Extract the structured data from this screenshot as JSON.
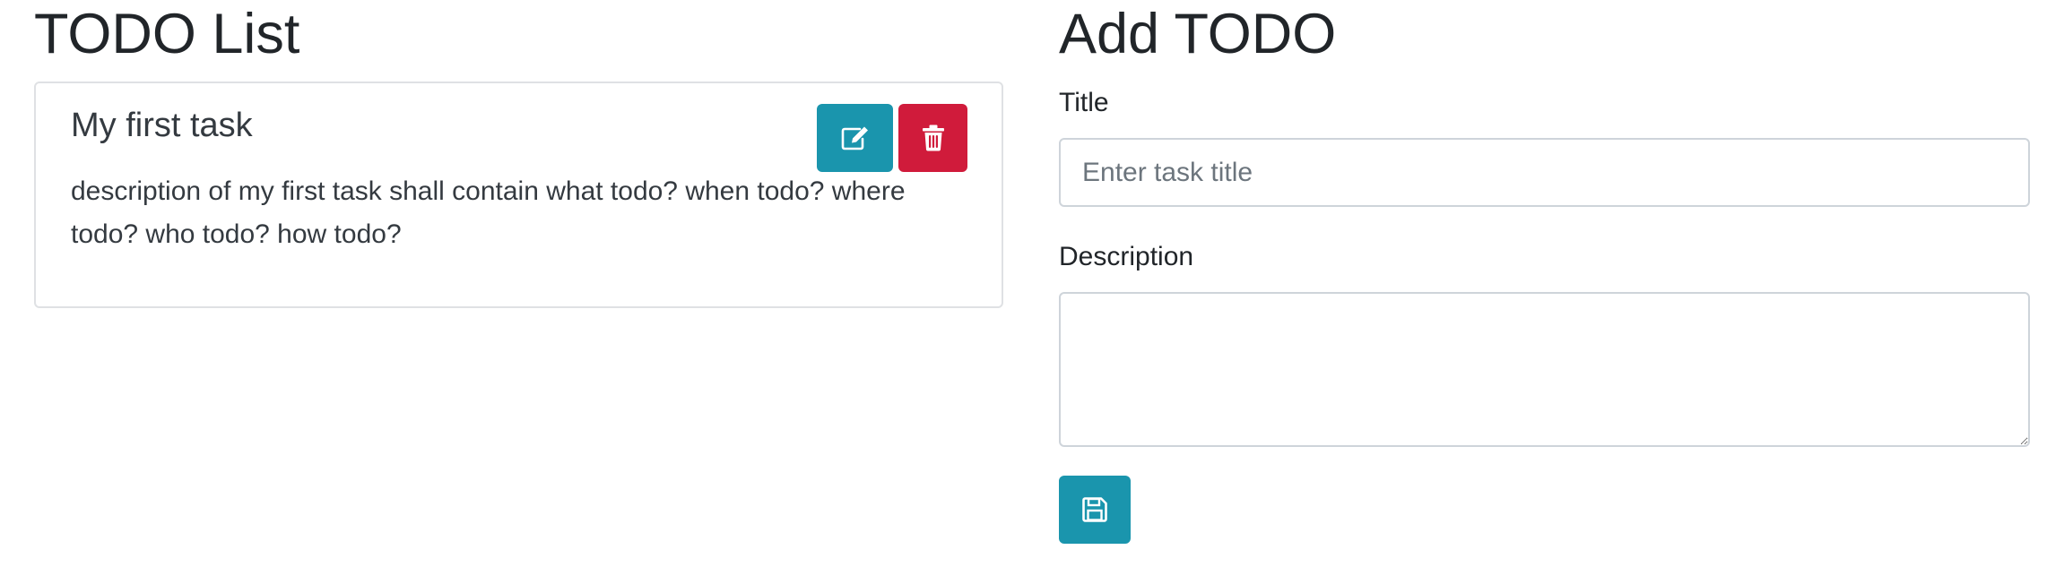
{
  "todo_list": {
    "heading": "TODO List",
    "items": [
      {
        "title": "My first task",
        "description": "description of my first task shall contain what todo? when todo? where todo? who todo? how todo?"
      }
    ]
  },
  "add_todo": {
    "heading": "Add TODO",
    "title_label": "Title",
    "title_placeholder": "Enter task title",
    "title_value": "",
    "description_label": "Description",
    "description_value": ""
  },
  "icons": {
    "edit": "edit-icon",
    "delete": "trash-icon",
    "save": "save-icon"
  },
  "colors": {
    "edit_button": "#1a95ad",
    "delete_button": "#d01b3b",
    "save_button": "#1a95ad"
  }
}
